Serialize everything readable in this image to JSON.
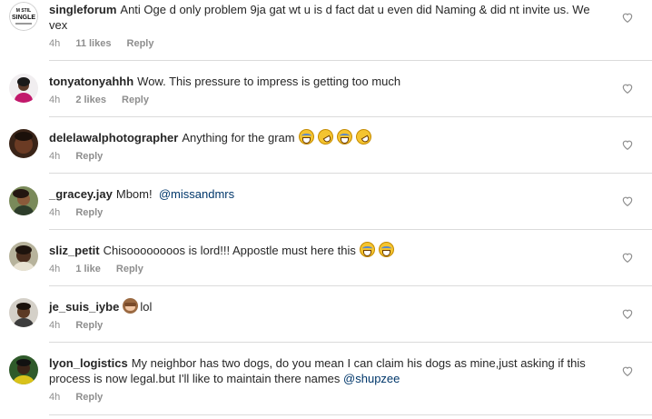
{
  "icons": {
    "like": "heart-outline-icon"
  },
  "colors": {
    "text": "#262626",
    "muted": "#8e8e8e",
    "link": "#00376b",
    "divider": "#dbdbdb"
  },
  "comments": [
    {
      "username": "singleforum",
      "avatar_text": [
        "M STIL",
        "SINGLE"
      ],
      "text": "Anti Oge d only problem 9ja gat wt u is d fact dat u even did Naming & did nt invite us. We vex",
      "time": "4h",
      "likes": "11 likes",
      "reply": "Reply"
    },
    {
      "username": "tonyatonyahhh",
      "text": "Wow. This pressure to impress is getting too much",
      "time": "4h",
      "likes": "2 likes",
      "reply": "Reply"
    },
    {
      "username": "delelawalphotographer",
      "text": "Anything for the gram",
      "emojis": [
        "face-with-tears-of-joy",
        "rolling-on-floor-laughing",
        "face-with-tears-of-joy",
        "rolling-on-floor-laughing"
      ],
      "time": "4h",
      "reply": "Reply"
    },
    {
      "username": "_gracey.jay",
      "text": "Mbom!",
      "mention": "@missandmrs",
      "time": "4h",
      "reply": "Reply"
    },
    {
      "username": "sliz_petit",
      "text": "Chisoooooooos is lord!!! Appostle must here this",
      "emojis": [
        "face-with-tears-of-joy",
        "face-with-tears-of-joy"
      ],
      "time": "4h",
      "likes": "1 like",
      "reply": "Reply"
    },
    {
      "username": "je_suis_iybe",
      "emojis": [
        "see-no-evil-monkey"
      ],
      "text": "lol",
      "time": "4h",
      "reply": "Reply"
    },
    {
      "username": "lyon_logistics",
      "text": "My neighbor has two dogs, do you mean I can claim his dogs as mine,just asking if this process is now legal.but I'll like to maintain there names",
      "mention": "@shupzee",
      "time": "4h",
      "reply": "Reply"
    }
  ]
}
